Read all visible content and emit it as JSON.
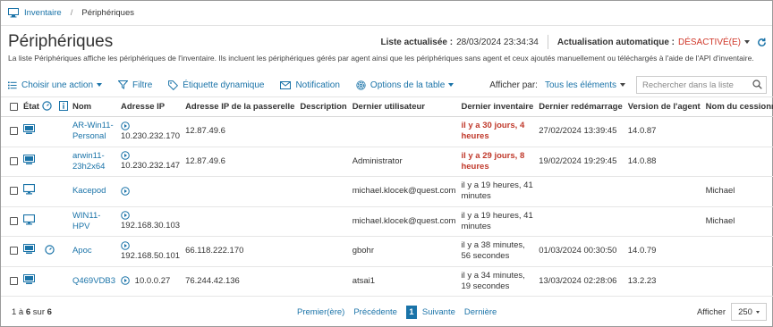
{
  "breadcrumb": {
    "root": "Inventaire",
    "current": "Périphériques"
  },
  "page": {
    "title": "Périphériques",
    "last_updated_label": "Liste actualisée :",
    "last_updated_value": "28/03/2024 23:34:34",
    "auto_refresh_label": "Actualisation automatique :",
    "auto_refresh_value": "DÉSACTIVÉ(E)",
    "description": "La liste Périphériques affiche les périphériques de l'inventaire. Ils incluent les périphériques gérés par agent ainsi que les périphériques sans agent et ceux ajoutés manuellement ou téléchargés à l'aide de l'API d'inventaire."
  },
  "toolbar": {
    "choose_action": "Choisir une action",
    "filter": "Filtre",
    "dynamic_label": "Étiquette dynamique",
    "notification": "Notification",
    "table_options": "Options de la table",
    "show_by_label": "Afficher par:",
    "show_by_value": "Tous les éléments",
    "search_placeholder": "Rechercher dans la liste"
  },
  "table": {
    "headers": {
      "state": "État",
      "name": "Nom",
      "ip": "Adresse IP",
      "gateway": "Adresse IP de la passerelle",
      "description": "Description",
      "last_user": "Dernier utilisateur",
      "last_inventory": "Dernier inventaire",
      "last_reboot": "Dernier redémarrage",
      "agent_version": "Version de l'agent",
      "assignee": "Nom du cessionnaire"
    },
    "rows": [
      {
        "name": "AR-Win11-Personal",
        "ip": "10.230.232.170",
        "gateway": "12.87.49.6",
        "description": "",
        "last_user": "",
        "last_inventory": "il y a 30 jours, 4 heures",
        "last_reboot": "27/02/2024 13:39:45",
        "agent_version": "14.0.87",
        "assignee": ""
      },
      {
        "name": "arwin11-23h2x64",
        "ip": "10.230.232.147",
        "gateway": "12.87.49.6",
        "description": "",
        "last_user": "Administrator",
        "last_inventory": "il y a 29 jours, 8 heures",
        "last_reboot": "19/02/2024 19:29:45",
        "agent_version": "14.0.88",
        "assignee": ""
      },
      {
        "name": "Kacepod",
        "ip": "",
        "gateway": "",
        "description": "",
        "last_user": "michael.klocek@quest.com",
        "last_inventory": "il y a 19 heures, 41 minutes",
        "last_reboot": "",
        "agent_version": "",
        "assignee": "Michael"
      },
      {
        "name": "WIN11-HPV",
        "ip": "192.168.30.103",
        "gateway": "",
        "description": "",
        "last_user": "michael.klocek@quest.com",
        "last_inventory": "il y a 19 heures, 41 minutes",
        "last_reboot": "",
        "agent_version": "",
        "assignee": "Michael"
      },
      {
        "name": "Apoc",
        "ip": "192.168.50.101",
        "gateway": "66.118.222.170",
        "description": "",
        "last_user": "gbohr",
        "last_inventory": "il y a 38 minutes, 56 secondes",
        "last_reboot": "01/03/2024 00:30:50",
        "agent_version": "14.0.79",
        "assignee": ""
      },
      {
        "name": "Q469VDB3",
        "ip": "10.0.0.27",
        "gateway": "76.244.42.136",
        "description": "",
        "last_user": "atsai1",
        "last_inventory": "il y a 34 minutes, 19 secondes",
        "last_reboot": "13/03/2024 02:28:06",
        "agent_version": "13.2.23",
        "assignee": ""
      }
    ]
  },
  "footer": {
    "count_start": "1",
    "count_mid": " à ",
    "count_end": "6",
    "count_of": " sur ",
    "count_total": "6",
    "first": "Premier(ère)",
    "previous": "Précédente",
    "current_page": "1",
    "next": "Suivante",
    "last": "Dernière",
    "show_label": "Afficher",
    "show_value": "250"
  },
  "colors": {
    "accent": "#1a73a8",
    "alert": "#c0392b",
    "auto_refresh_off": "#d0382a"
  }
}
